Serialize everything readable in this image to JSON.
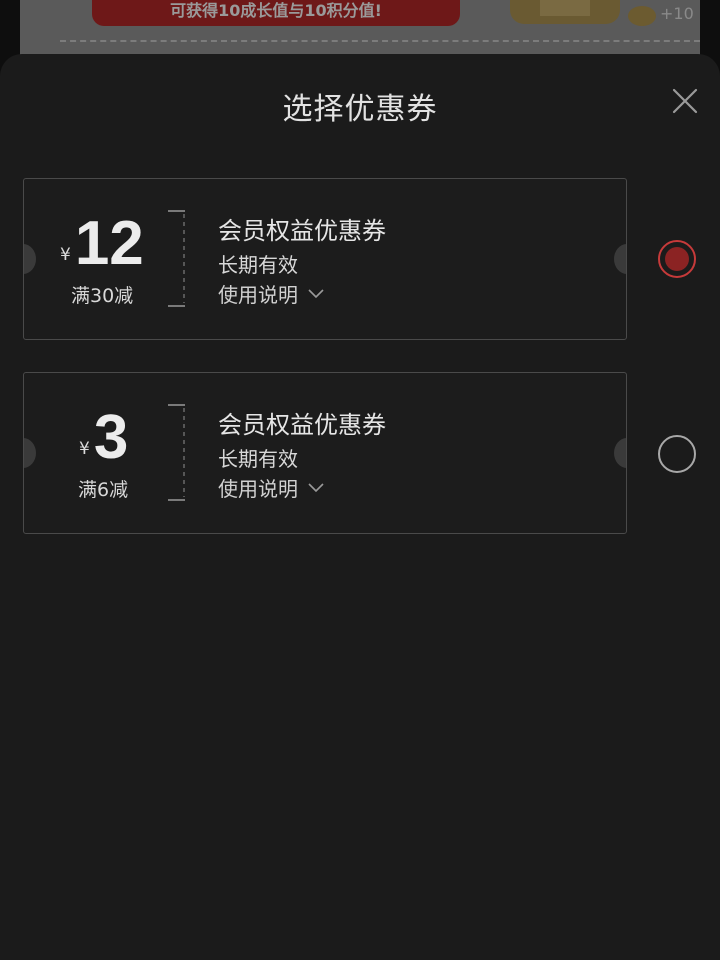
{
  "background": {
    "banner_text": "可获得10成长值与10积分值!",
    "points_plus": "+10"
  },
  "sheet": {
    "title": "选择优惠券",
    "close_icon": "close-icon"
  },
  "coupons": [
    {
      "currency": "¥",
      "amount": "12",
      "threshold": "满30减",
      "name": "会员权益优惠券",
      "validity": "长期有效",
      "usage": "使用说明",
      "selected": true
    },
    {
      "currency": "¥",
      "amount": "3",
      "threshold": "满6减",
      "name": "会员权益优惠券",
      "validity": "长期有效",
      "usage": "使用说明",
      "selected": false
    }
  ],
  "colors": {
    "accent": "#c63a3a",
    "sheet_bg": "#1b1b1b"
  }
}
